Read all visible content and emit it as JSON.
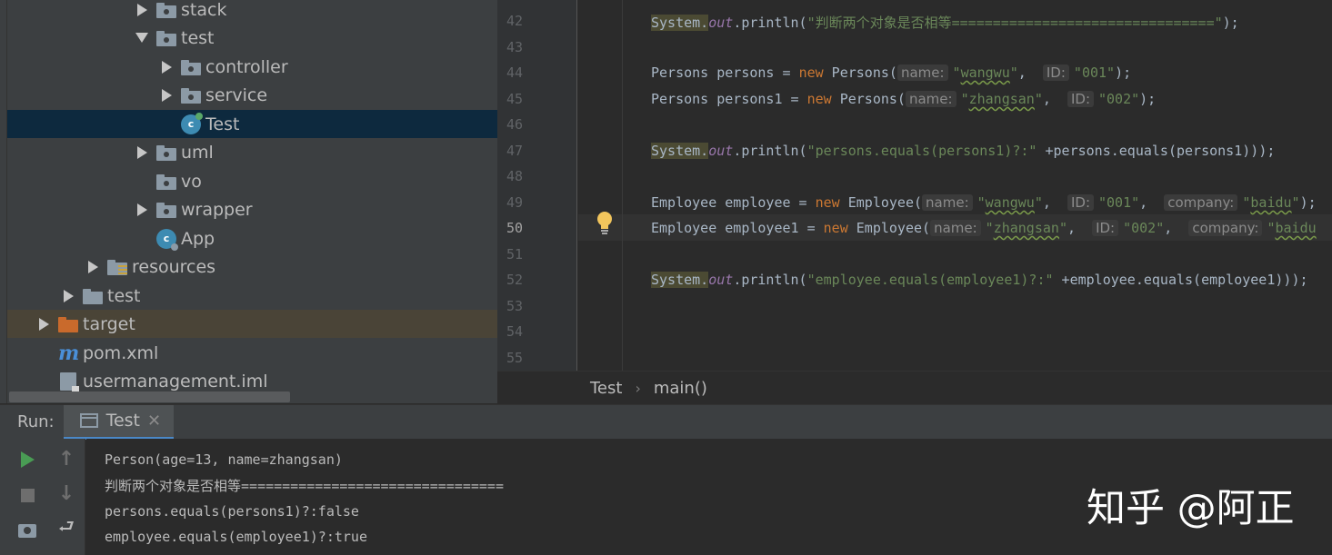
{
  "project_tree": {
    "items": [
      {
        "label": "stack"
      },
      {
        "label": "test"
      },
      {
        "label": "controller"
      },
      {
        "label": "service"
      },
      {
        "label": "Test"
      },
      {
        "label": "uml"
      },
      {
        "label": "vo"
      },
      {
        "label": "wrapper"
      },
      {
        "label": "App"
      },
      {
        "label": "resources"
      },
      {
        "label": "test"
      },
      {
        "label": "target"
      },
      {
        "label": "pom.xml"
      },
      {
        "label": "usermanagement.iml"
      }
    ],
    "selected_item": "Test"
  },
  "editor": {
    "line_numbers": [
      "42",
      "43",
      "44",
      "45",
      "46",
      "47",
      "48",
      "49",
      "50",
      "51",
      "52",
      "53",
      "54",
      "55"
    ],
    "current_line": "50",
    "tokens": {
      "system": "System.",
      "out": "out",
      "println_open": ".println(",
      "close_paren": ");",
      "new_kw": "new",
      "concat_plus": " +",
      "persons_decl": "Persons persons = ",
      "persons1_decl": "Persons persons1 = ",
      "persons_ctor": " Persons(",
      "employee_decl": "Employee employee = ",
      "employee1_decl": "Employee employee1 = ",
      "employee_ctor": " Employee(",
      "comma": ",",
      "hint_name": "name:",
      "hint_id": "ID:",
      "hint_company": "company:",
      "quote": "\"",
      "str_compare": "\"判断两个对象是否相等================================\"",
      "str_wangwu": "wangwu",
      "str_zhangsan": "zhangsan",
      "str_001": "001",
      "str_002": "002",
      "str_baidu": "baidu",
      "str_persons_eq": "\"persons.equals(persons1)?:\"",
      "expr_persons_eq": "persons.equals(persons1)",
      "str_employee_eq": "\"employee.equals(employee1)?:\"",
      "expr_employee_eq": "employee.equals(employee1)",
      "close_call": ");",
      "close_paren_only": ")"
    }
  },
  "breadcrumb": {
    "class": "Test",
    "separator": "›",
    "method": "main()"
  },
  "run_window": {
    "label": "Run:",
    "tab_label": "Test",
    "tab_close": "✕",
    "output_lines": [
      "Person(age=13, name=zhangsan)",
      "判断两个对象是否相等================================",
      "persons.equals(persons1)?:false",
      "employee.equals(employee1)?:true"
    ]
  },
  "watermark": "知乎 @阿正",
  "colors": {
    "keyword": "#cc7832",
    "string": "#6a8759",
    "static_field": "#9876aa",
    "selection": "#0d293e",
    "run_green": "#499c54"
  }
}
